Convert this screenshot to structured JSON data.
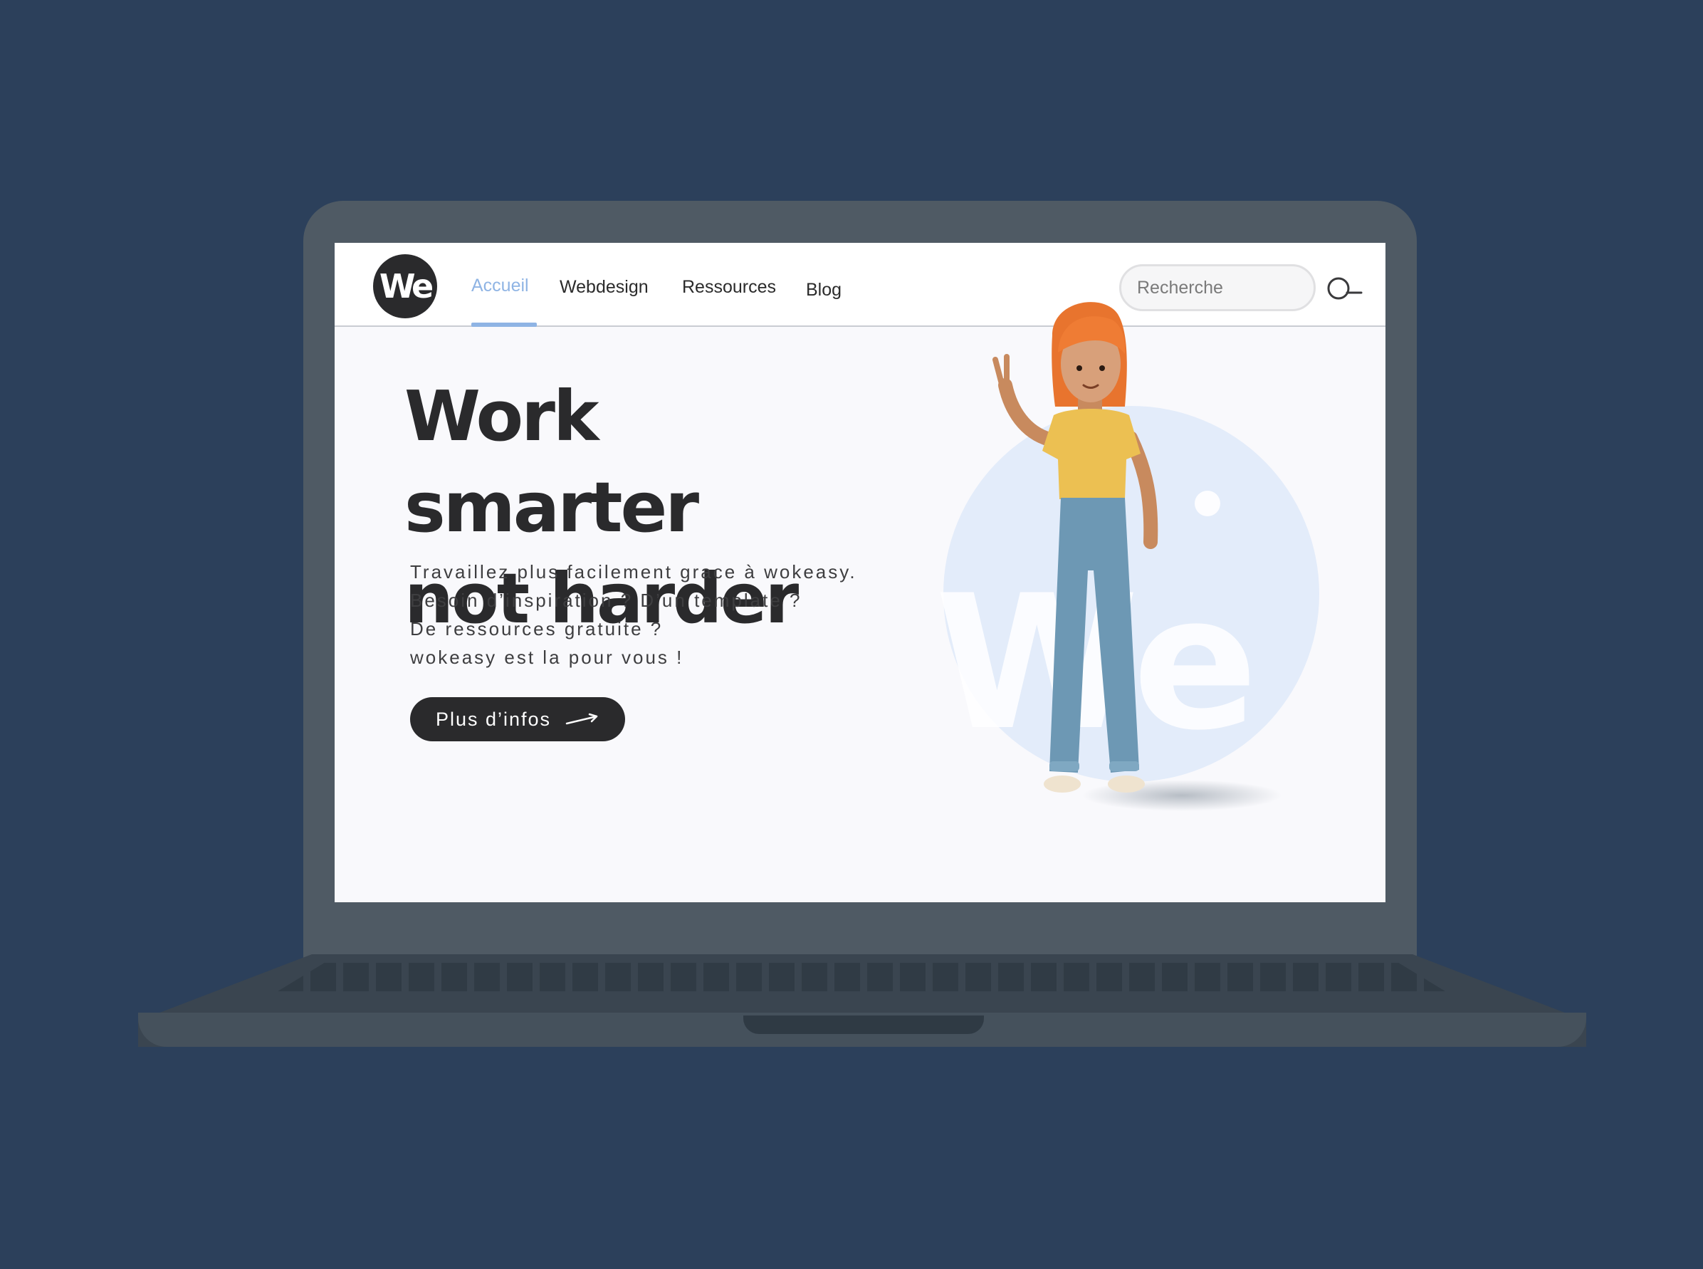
{
  "logo": {
    "text": "We"
  },
  "nav": {
    "items": [
      {
        "label": "Accueil",
        "active": true
      },
      {
        "label": "Webdesign",
        "active": false
      },
      {
        "label": "Ressources",
        "active": false
      },
      {
        "label": "Blog",
        "active": false
      }
    ]
  },
  "search": {
    "placeholder": "Recherche",
    "value": ""
  },
  "hero": {
    "title_lines": [
      "Work smarter",
      "not harder"
    ],
    "text_lines": [
      "Travaillez plus facilement grace à wokeasy.",
      "Besoin d’inspiration ? D’un template ?",
      "De ressources gratuite ?",
      "wokeasy est la pour vous !"
    ],
    "cta_label": "Plus d’infos",
    "watermark": "We"
  },
  "colors": {
    "background": "#2c405b",
    "accent": "#8fb4e4",
    "dark": "#2a2a2c",
    "circle": "#e3ecfa"
  },
  "icons": {
    "search": "search-icon",
    "cta_arrow": "arrow-right-icon"
  }
}
